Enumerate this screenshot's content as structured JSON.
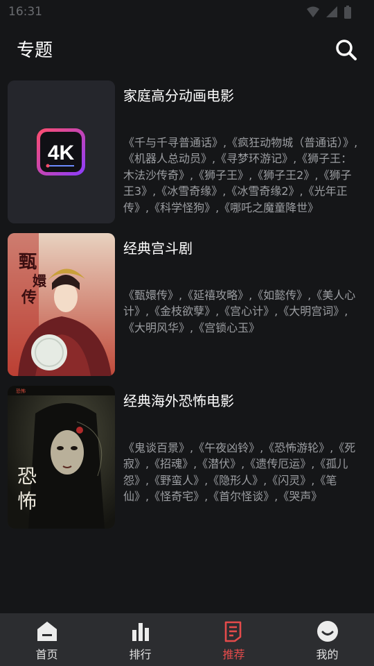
{
  "status_bar": {
    "time": "16:31"
  },
  "header": {
    "title": "专题"
  },
  "topics": [
    {
      "title": "家庭高分动画电影",
      "description": "《千与千寻普通话》,《疯狂动物城（普通话）》,《机器人总动员》,《寻梦环游记》,《狮子王：木法沙传奇》,《狮子王》,《狮子王2》,《狮子王3》,《冰雪奇缘》,《冰雪奇缘2》,《光年正传》,《科学怪狗》,《哪吒之魔童降世》",
      "thumb_text": "4K"
    },
    {
      "title": "经典宫斗剧",
      "description": "《甄嬛传》,《延禧攻略》,《如懿传》,《美人心计》,《金枝欲孽》,《宫心计》,《大明宫词》,《大明风华》,《宫锁心玉》"
    },
    {
      "title": "经典海外恐怖电影",
      "description": "《鬼谈百景》,《午夜凶铃》,《恐怖游轮》,《死寂》,《招魂》,《潜伏》,《遗传厄运》,《孤儿怨》,《野蛮人》,《隐形人》,《闪灵》,《笔仙》,《怪奇宅》,《首尔怪谈》,《哭声》"
    }
  ],
  "bottom_nav": {
    "items": [
      {
        "label": "首页",
        "icon": "home-icon"
      },
      {
        "label": "排行",
        "icon": "bar-chart-icon"
      },
      {
        "label": "推荐",
        "icon": "document-icon",
        "active": true
      },
      {
        "label": "我的",
        "icon": "smiley-icon"
      }
    ]
  },
  "colors": {
    "accent": "#e54b4b",
    "background": "#151618",
    "nav_bg": "#2c2d30"
  }
}
